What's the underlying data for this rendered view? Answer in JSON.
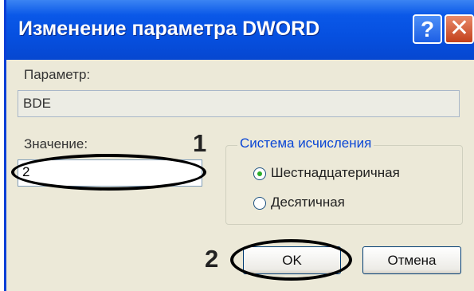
{
  "dialog": {
    "title": "Изменение параметра DWORD",
    "help_glyph": "?",
    "close_glyph": "✕"
  },
  "parameter": {
    "label": "Параметр:",
    "value": "BDE"
  },
  "value_field": {
    "label": "Значение:",
    "value": "2"
  },
  "number_system": {
    "legend": "Система исчисления",
    "options": [
      {
        "label": "Шестнадцатеричная",
        "selected": true
      },
      {
        "label": "Десятичная",
        "selected": false
      }
    ]
  },
  "buttons": {
    "ok": "OK",
    "cancel": "Отмена"
  },
  "annotations": {
    "marker_1": "1",
    "marker_2": "2"
  },
  "colors": {
    "titlebar": "#0650e0",
    "dialog_bg": "#ece9d8",
    "legend_text": "#0a46d5",
    "radio_dot": "#2bad2b",
    "annotation": "#000000"
  }
}
